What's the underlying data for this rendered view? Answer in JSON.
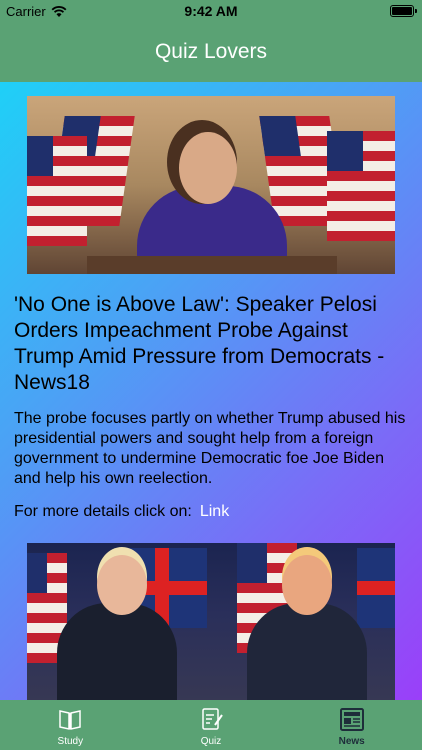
{
  "status_bar": {
    "carrier": "Carrier",
    "time": "9:42 AM"
  },
  "nav": {
    "title": "Quiz Lovers"
  },
  "articles": [
    {
      "headline": "'No One is Above Law': Speaker Pelosi Orders Impeachment Probe Against Trump Amid Pressure from Democrats - News18",
      "summary": "The probe focuses partly on whether Trump abused his presidential powers and sought help from a foreign government to undermine Democratic foe Joe Biden and help his own reelection.",
      "details_label": "For more details click on:",
      "link_label": "Link"
    }
  ],
  "tabs": [
    {
      "label": "Study",
      "icon": "book-icon",
      "active": false
    },
    {
      "label": "Quiz",
      "icon": "quiz-icon",
      "active": false
    },
    {
      "label": "News",
      "icon": "newspaper-icon",
      "active": true
    }
  ],
  "colors": {
    "bar_green": "#5aa274",
    "gradient_start": "#1fd0f7",
    "gradient_end": "#9a3ff9",
    "active_tab": "#1e2d3a"
  }
}
